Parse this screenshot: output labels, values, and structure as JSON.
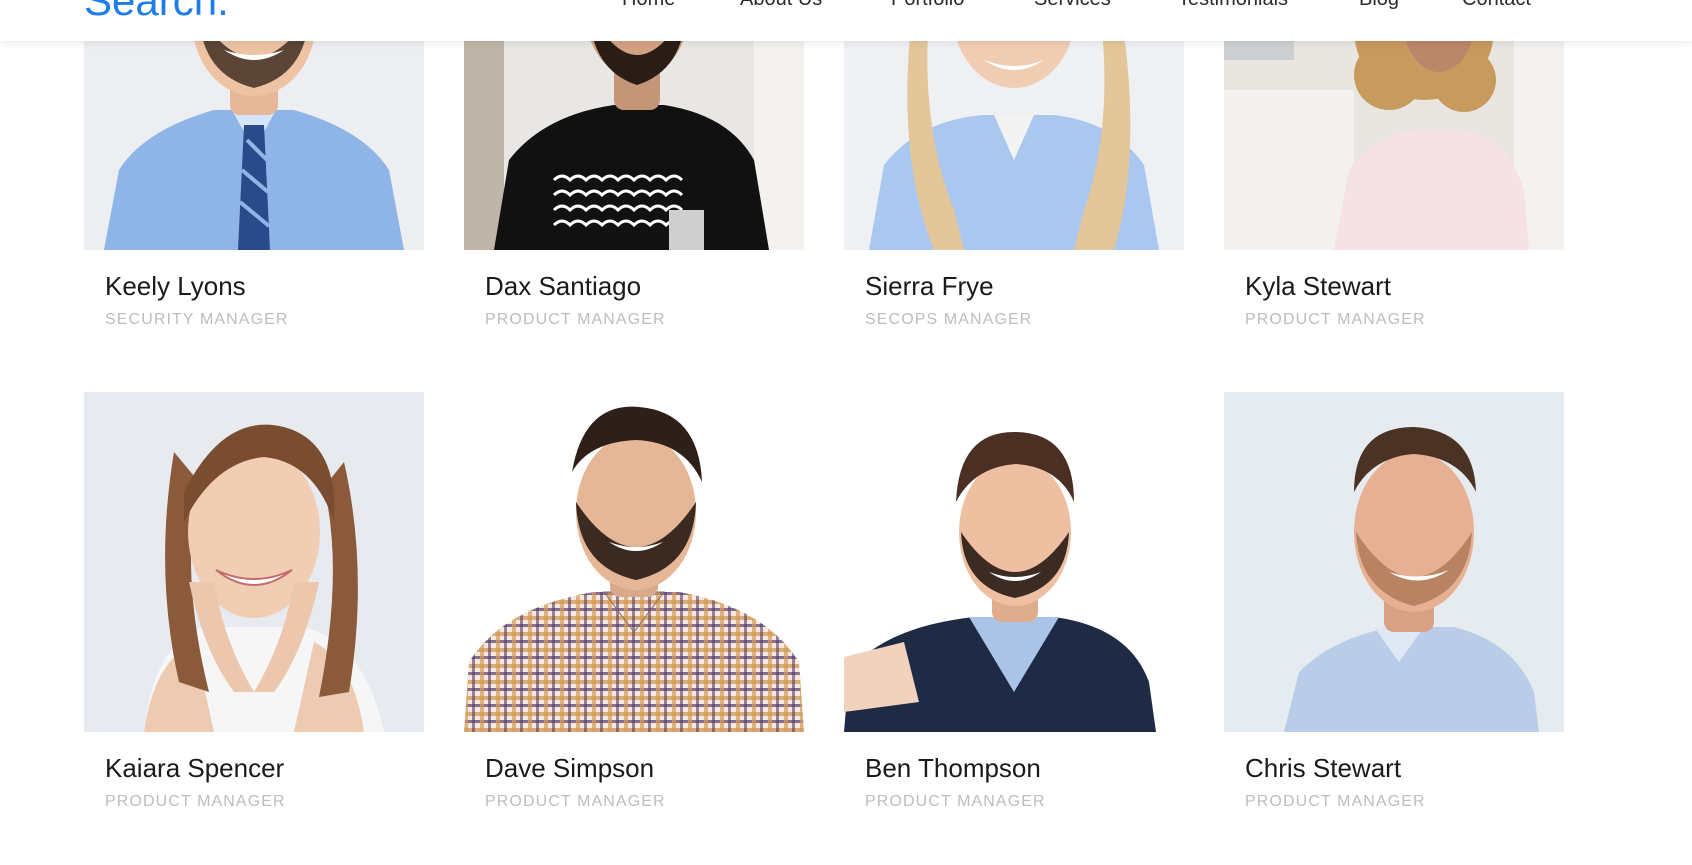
{
  "site": {
    "logo_text": "Search.",
    "brand_color": "#1e7de6"
  },
  "nav": {
    "items": [
      {
        "label": "Home"
      },
      {
        "label": "About Us"
      },
      {
        "label": "Portfolio"
      },
      {
        "label": "Services"
      },
      {
        "label": "Testimonials"
      },
      {
        "label": "Blog"
      },
      {
        "label": "Contact"
      }
    ]
  },
  "team": {
    "members": [
      {
        "name": "Keely Lyons",
        "role": "SECURITY MANAGER"
      },
      {
        "name": "Dax Santiago",
        "role": "PRODUCT MANAGER"
      },
      {
        "name": "Sierra Frye",
        "role": "SECOPS MANAGER"
      },
      {
        "name": "Kyla Stewart",
        "role": "PRODUCT MANAGER"
      },
      {
        "name": "Kaiara Spencer",
        "role": "PRODUCT MANAGER"
      },
      {
        "name": "Dave Simpson",
        "role": "PRODUCT MANAGER"
      },
      {
        "name": "Ben Thompson",
        "role": "PRODUCT MANAGER"
      },
      {
        "name": "Chris Stewart",
        "role": "PRODUCT MANAGER"
      }
    ]
  }
}
